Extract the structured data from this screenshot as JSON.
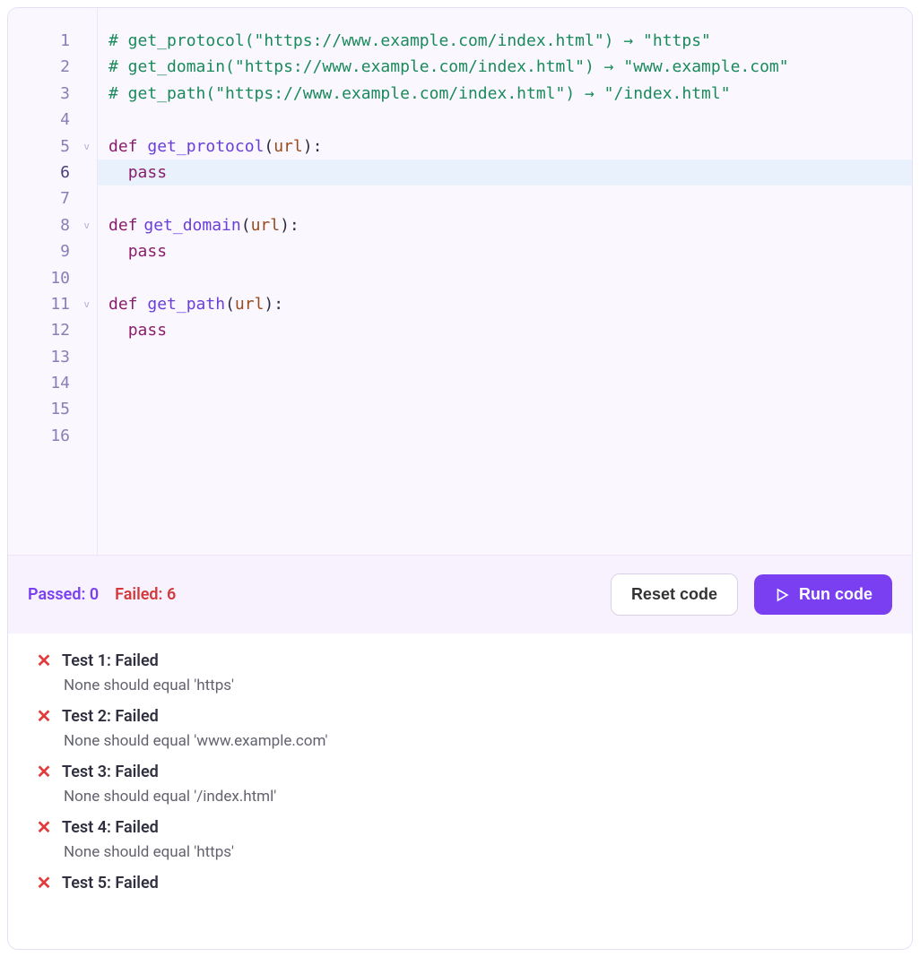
{
  "editor": {
    "lines": [
      {
        "n": 1,
        "fold": "",
        "active": false,
        "hl": false,
        "tokens": [
          {
            "t": "comment",
            "v": "# get_protocol(\"https://www.example.com/index.html\") → \"https\""
          }
        ]
      },
      {
        "n": 2,
        "fold": "",
        "active": false,
        "hl": false,
        "tokens": [
          {
            "t": "comment",
            "v": "# get_domain(\"https://www.example.com/index.html\") → \"www.example.com\""
          }
        ]
      },
      {
        "n": 3,
        "fold": "",
        "active": false,
        "hl": false,
        "tokens": [
          {
            "t": "comment",
            "v": "# get_path(\"https://www.example.com/index.html\") → \"/index.html\""
          }
        ]
      },
      {
        "n": 4,
        "fold": "",
        "active": false,
        "hl": false,
        "tokens": []
      },
      {
        "n": 5,
        "fold": "v",
        "active": false,
        "hl": false,
        "tokens": [
          {
            "t": "kw",
            "v": "def "
          },
          {
            "t": "fn",
            "v": "get_protocol"
          },
          {
            "t": "text",
            "v": "("
          },
          {
            "t": "param",
            "v": "url"
          },
          {
            "t": "text",
            "v": "):"
          }
        ]
      },
      {
        "n": 6,
        "fold": "",
        "active": true,
        "hl": true,
        "tokens": [
          {
            "t": "text",
            "v": "  "
          },
          {
            "t": "kw",
            "v": "pass"
          }
        ]
      },
      {
        "n": 7,
        "fold": "",
        "active": false,
        "hl": false,
        "tokens": []
      },
      {
        "n": 8,
        "fold": "v",
        "active": false,
        "hl": false,
        "tokens": [
          {
            "t": "kw",
            "v": "def"
          },
          {
            "t": "caret",
            "v": ""
          },
          {
            "t": "fn",
            "v": "get_domain"
          },
          {
            "t": "text",
            "v": "("
          },
          {
            "t": "param",
            "v": "url"
          },
          {
            "t": "text",
            "v": "):"
          }
        ]
      },
      {
        "n": 9,
        "fold": "",
        "active": false,
        "hl": false,
        "tokens": [
          {
            "t": "text",
            "v": "  "
          },
          {
            "t": "kw",
            "v": "pass"
          }
        ]
      },
      {
        "n": 10,
        "fold": "",
        "active": false,
        "hl": false,
        "tokens": []
      },
      {
        "n": 11,
        "fold": "v",
        "active": false,
        "hl": false,
        "tokens": [
          {
            "t": "kw",
            "v": "def "
          },
          {
            "t": "fn",
            "v": "get_path"
          },
          {
            "t": "text",
            "v": "("
          },
          {
            "t": "param",
            "v": "url"
          },
          {
            "t": "text",
            "v": "):"
          }
        ]
      },
      {
        "n": 12,
        "fold": "",
        "active": false,
        "hl": false,
        "tokens": [
          {
            "t": "text",
            "v": "  "
          },
          {
            "t": "kw",
            "v": "pass"
          }
        ]
      },
      {
        "n": 13,
        "fold": "",
        "active": false,
        "hl": false,
        "tokens": []
      },
      {
        "n": 14,
        "fold": "",
        "active": false,
        "hl": false,
        "tokens": []
      },
      {
        "n": 15,
        "fold": "",
        "active": false,
        "hl": false,
        "tokens": []
      },
      {
        "n": 16,
        "fold": "",
        "active": false,
        "hl": false,
        "tokens": []
      }
    ]
  },
  "toolbar": {
    "passed_label": "Passed: 0",
    "failed_label": "Failed: 6",
    "reset_label": "Reset code",
    "run_label": "Run code"
  },
  "results": {
    "tests": [
      {
        "title": "Test 1: Failed",
        "msg": "None should equal 'https'"
      },
      {
        "title": "Test 2: Failed",
        "msg": "None should equal 'www.example.com'"
      },
      {
        "title": "Test 3: Failed",
        "msg": "None should equal '/index.html'"
      },
      {
        "title": "Test 4: Failed",
        "msg": "None should equal 'https'"
      },
      {
        "title": "Test 5: Failed",
        "msg": ""
      }
    ]
  }
}
